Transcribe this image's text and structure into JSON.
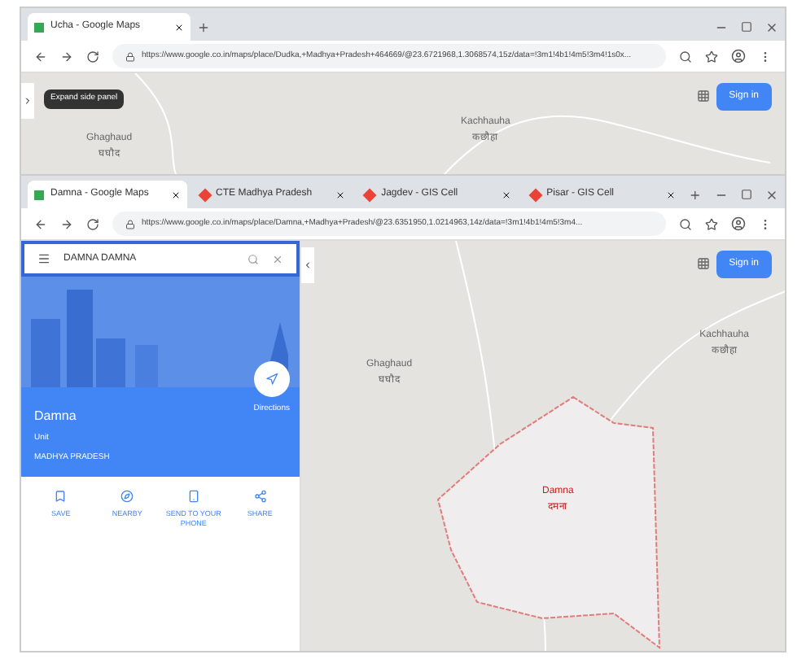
{
  "back_window": {
    "tabs": [
      {
        "label": "Ucha - Google Maps",
        "selected": true
      }
    ],
    "url": "https://www.google.co.in/maps/place/Dudka,+Madhya+Pradesh+464669/@23.6721968,1.3068574,15z/data=!3m1!4b1!4m5!3m4!1s0x...",
    "tooltip": "Expand side panel",
    "sign_in": "Sign in",
    "map_labels": [
      {
        "name": "Ghaghaud",
        "local": "घघौद"
      },
      {
        "name": "Kachhauha",
        "local": "कछौहा"
      }
    ]
  },
  "front_window": {
    "tabs": [
      {
        "label": "Damna - Google Maps",
        "selected": true
      },
      {
        "label": "CTE Madhya Pradesh",
        "selected": false
      },
      {
        "label": "Jagdev - GIS Cell",
        "selected": false
      },
      {
        "label": "Pisar - GIS Cell",
        "selected": false
      }
    ],
    "url": "https://www.google.co.in/maps/place/Damna,+Madhya+Pradesh/@23.6351950,1.0214963,14z/data=!3m1!4b1!4m5!3m4...",
    "search": {
      "value": "DAMNA DAMNA"
    },
    "place": {
      "name": "Damna",
      "type": "Unit",
      "region": "MADHYA PRADESH",
      "directions": "Directions"
    },
    "actions": [
      {
        "kind": "save",
        "label": "SAVE"
      },
      {
        "kind": "nearby",
        "label": "NEARBY"
      },
      {
        "kind": "phone",
        "label": "SEND TO YOUR PHONE"
      },
      {
        "kind": "share",
        "label": "SHARE"
      }
    ],
    "sign_in": "Sign in",
    "map_labels": [
      {
        "name": "Ghaghaud",
        "local": "घघौद"
      },
      {
        "name": "Kachhauha",
        "local": "कछौहा"
      }
    ],
    "area_label": {
      "name": "Damna",
      "local": "दमना"
    }
  }
}
